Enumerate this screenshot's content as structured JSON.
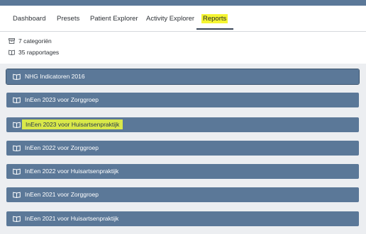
{
  "nav": {
    "tabs": [
      {
        "label": "Dashboard",
        "active": false
      },
      {
        "label": "Presets",
        "active": false
      },
      {
        "label": "Patient Explorer",
        "active": false
      },
      {
        "label": "Activity Explorer",
        "active": false
      },
      {
        "label": "Reports",
        "active": true,
        "highlighted": true
      }
    ]
  },
  "summary": {
    "categories": {
      "icon": "archive-icon",
      "text": "7 categoriën"
    },
    "reports": {
      "icon": "book-icon",
      "text": "35 rapportages"
    }
  },
  "report_rows": [
    {
      "icon": "book-icon",
      "label": "NHG Indicatoren 2016"
    },
    {
      "icon": "book-icon",
      "label": "InEen 2023 voor Zorggroep"
    },
    {
      "icon": "book-icon",
      "label": "InEen 2023 voor Huisartsenpraktijk",
      "highlighted": true
    },
    {
      "icon": "book-icon",
      "label": "InEen 2022 voor Zorggroep"
    },
    {
      "icon": "book-icon",
      "label": "InEen 2022 voor Huisartsenpraktijk"
    },
    {
      "icon": "book-icon",
      "label": "InEen 2021 voor Zorggroep"
    },
    {
      "icon": "book-icon",
      "label": "InEen 2021 voor Huisartsenpraktijk"
    }
  ],
  "colors": {
    "row_background": "#5b7898",
    "highlight": "#f5f532",
    "list_background": "#eceef1"
  }
}
